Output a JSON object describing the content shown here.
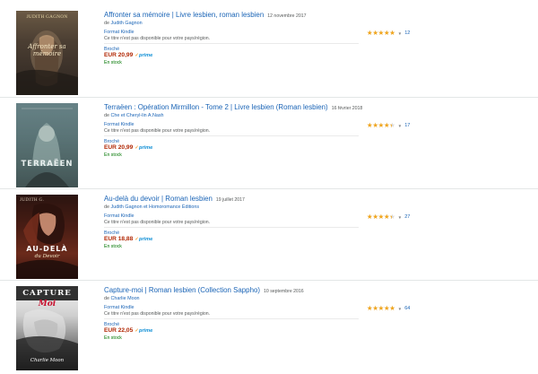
{
  "results": [
    {
      "title": "Affronter sa mémoire | Livre lesbien, roman lesbien",
      "date": "12 novembre 2017",
      "by_prefix": "de",
      "authors": "Judith Gagnon",
      "format1": "Format Kindle",
      "unavailable": "Ce titre n'est pas disponible pour votre pays/région.",
      "format2": "Broché",
      "price": "EUR 20,99",
      "prime": "prime",
      "stock": "En stock",
      "rating": 5.0,
      "reviews": "12",
      "cover": {
        "top": "JUDITH GAGNON",
        "script": "Affronter sa mémoire",
        "bottom": ""
      }
    },
    {
      "title": "Terraëen : Opération Mirmillon - Tome 2 | Livre lesbien (Roman lesbien)",
      "date": "16 février 2018",
      "by_prefix": "de",
      "authors": "Che et Cheryl-lin A.Nash",
      "format1": "Format Kindle",
      "unavailable": "Ce titre n'est pas disponible pour votre pays/région.",
      "format2": "Broché",
      "price": "EUR 20,99",
      "prime": "prime",
      "stock": "En stock",
      "rating": 4.5,
      "reviews": "17",
      "cover": {
        "top": "",
        "script": "",
        "bottom": "TERRAËEN"
      }
    },
    {
      "title": "Au-delà du devoir | Roman lesbien",
      "date": "19 juillet 2017",
      "by_prefix": "de",
      "authors": "Judith Gagnon et Homoromance Éditions",
      "format1": "Format Kindle",
      "unavailable": "Ce titre n'est pas disponible pour votre pays/région.",
      "format2": "Broché",
      "price": "EUR 18,88",
      "prime": "prime",
      "stock": "En stock",
      "rating": 4.5,
      "reviews": "27",
      "cover": {
        "top": "JUDITH G.",
        "script": "du Devoir",
        "bottom": "AU-DELÀ"
      }
    },
    {
      "title": "Capture-moi | Roman lesbien (Collection Sappho)",
      "date": "10 septembre 2016",
      "by_prefix": "de",
      "authors": "Charlie Moon",
      "format1": "Format Kindle",
      "unavailable": "Ce titre n'est pas disponible pour votre pays/région.",
      "format2": "Broché",
      "price": "EUR 22,05",
      "prime": "prime",
      "stock": "En stock",
      "rating": 5.0,
      "reviews": "64",
      "cover": {
        "top": "",
        "script": "Moi",
        "bottom": "CAPTURE",
        "author_script": "Charlie Moon"
      }
    }
  ],
  "icons": {
    "star": "star-icon",
    "prime_check": "check-icon",
    "caret": "chevron-down-icon"
  },
  "colors": {
    "link": "#1a64b6",
    "price": "#b12704",
    "stock": "#007600",
    "star": "#f2a61c",
    "prime": "#0f8fd6"
  }
}
